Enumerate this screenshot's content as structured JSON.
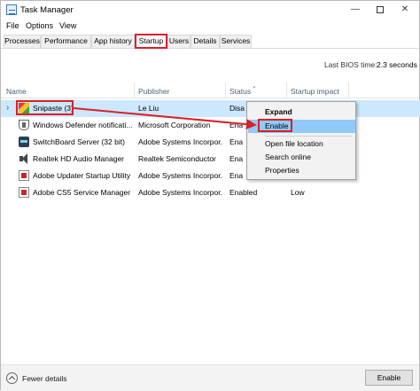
{
  "window": {
    "title": "Task Manager"
  },
  "menu": [
    "File",
    "Options",
    "View"
  ],
  "tabs": [
    "Processes",
    "Performance",
    "App history",
    "Startup",
    "Users",
    "Details",
    "Services"
  ],
  "active_tab": "Startup",
  "bios": {
    "label": "Last BIOS time:",
    "value": "2.3 seconds"
  },
  "columns": {
    "name": "Name",
    "publisher": "Publisher",
    "status": "Status",
    "impact": "Startup impact"
  },
  "rows": [
    {
      "name": "Snipaste (3)",
      "publisher": "Le Liu",
      "status": "Disa",
      "impact": "",
      "icon": "snipaste-icon",
      "selected": true
    },
    {
      "name": "Windows Defender notificati...",
      "publisher": "Microsoft Corporation",
      "status": "Ena",
      "impact": "",
      "icon": "shield-icon"
    },
    {
      "name": "SwitchBoard Server (32 bit)",
      "publisher": "Adobe Systems Incorpor...",
      "status": "Ena",
      "impact": "",
      "icon": "switchboard-icon"
    },
    {
      "name": "Realtek HD Audio Manager",
      "publisher": "Realtek Semiconductor",
      "status": "Ena",
      "impact": "",
      "icon": "speaker-icon"
    },
    {
      "name": "Adobe Updater Startup Utility",
      "publisher": "Adobe Systems Incorpor...",
      "status": "Ena",
      "impact": "",
      "icon": "adobe-icon"
    },
    {
      "name": "Adobe CS5 Service Manager",
      "publisher": "Adobe Systems Incorpor...",
      "status": "Enabled",
      "impact": "Low",
      "icon": "adobe-icon"
    }
  ],
  "context_menu": [
    "Expand",
    "Enable",
    "Open file location",
    "Search online",
    "Properties"
  ],
  "footer": {
    "fewer_details": "Fewer details",
    "enable_button": "Enable"
  },
  "colors": {
    "annotation": "#d8202a",
    "selected_row": "#cce8ff",
    "menu_hover": "#91c9f7"
  }
}
